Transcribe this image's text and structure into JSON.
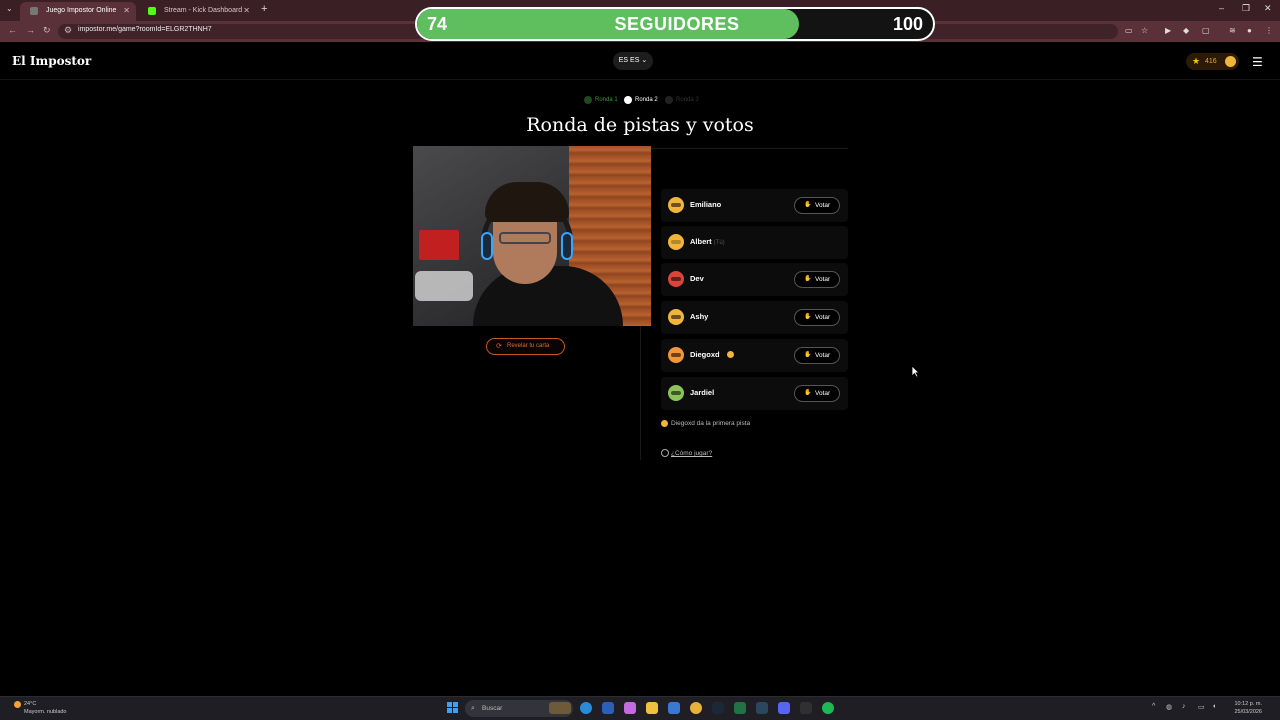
{
  "browser": {
    "tabs": [
      {
        "label": "Juego Impostor Online Gratis",
        "active": true
      },
      {
        "label": "Stream - Kick Dashboard",
        "active": false
      }
    ],
    "url": "impostor.me/game?roomId=ELGR2THNH7"
  },
  "overlay": {
    "current": "74",
    "label": "SEGUIDORES",
    "goal": "100",
    "progress_fraction": 0.74,
    "fill_color": "#5fbf5f"
  },
  "header": {
    "logo": "El Impostor",
    "language": "ES ES",
    "coins": "416",
    "accent": "#f5a524"
  },
  "rounds": [
    {
      "label": "Ronda 1",
      "state": "done"
    },
    {
      "label": "Ronda 2",
      "state": "current"
    },
    {
      "label": "Ronda 3",
      "state": "pending"
    }
  ],
  "title": "Ronda de pistas y votos",
  "reveal_button": "Revelar tu carta",
  "players": [
    {
      "name": "Emiliano",
      "you": "",
      "vote": "Votar",
      "avatar_color": "#f2b53b"
    },
    {
      "name": "Albert",
      "you": "(Tú)",
      "vote": "",
      "avatar_color": "#f2b53b"
    },
    {
      "name": "Dev",
      "you": "",
      "vote": "Votar",
      "avatar_color": "#d9453a"
    },
    {
      "name": "Ashy",
      "you": "",
      "vote": "Votar",
      "avatar_color": "#f2b53b"
    },
    {
      "name": "Diegoxd",
      "you": "",
      "vote": "Votar",
      "avatar_color": "#f2953b"
    },
    {
      "name": "Jardiel",
      "you": "",
      "vote": "Votar",
      "avatar_color": "#8cc45a"
    }
  ],
  "hint": "Diegoxd da la primera pista",
  "how_to_play": "¿Cómo jugar?",
  "taskbar": {
    "weather_temp": "24°C",
    "weather_desc": "Mayorm. nublado",
    "search_placeholder": "Buscar",
    "time": "10:12 p. m.",
    "date": "25/03/2026"
  }
}
